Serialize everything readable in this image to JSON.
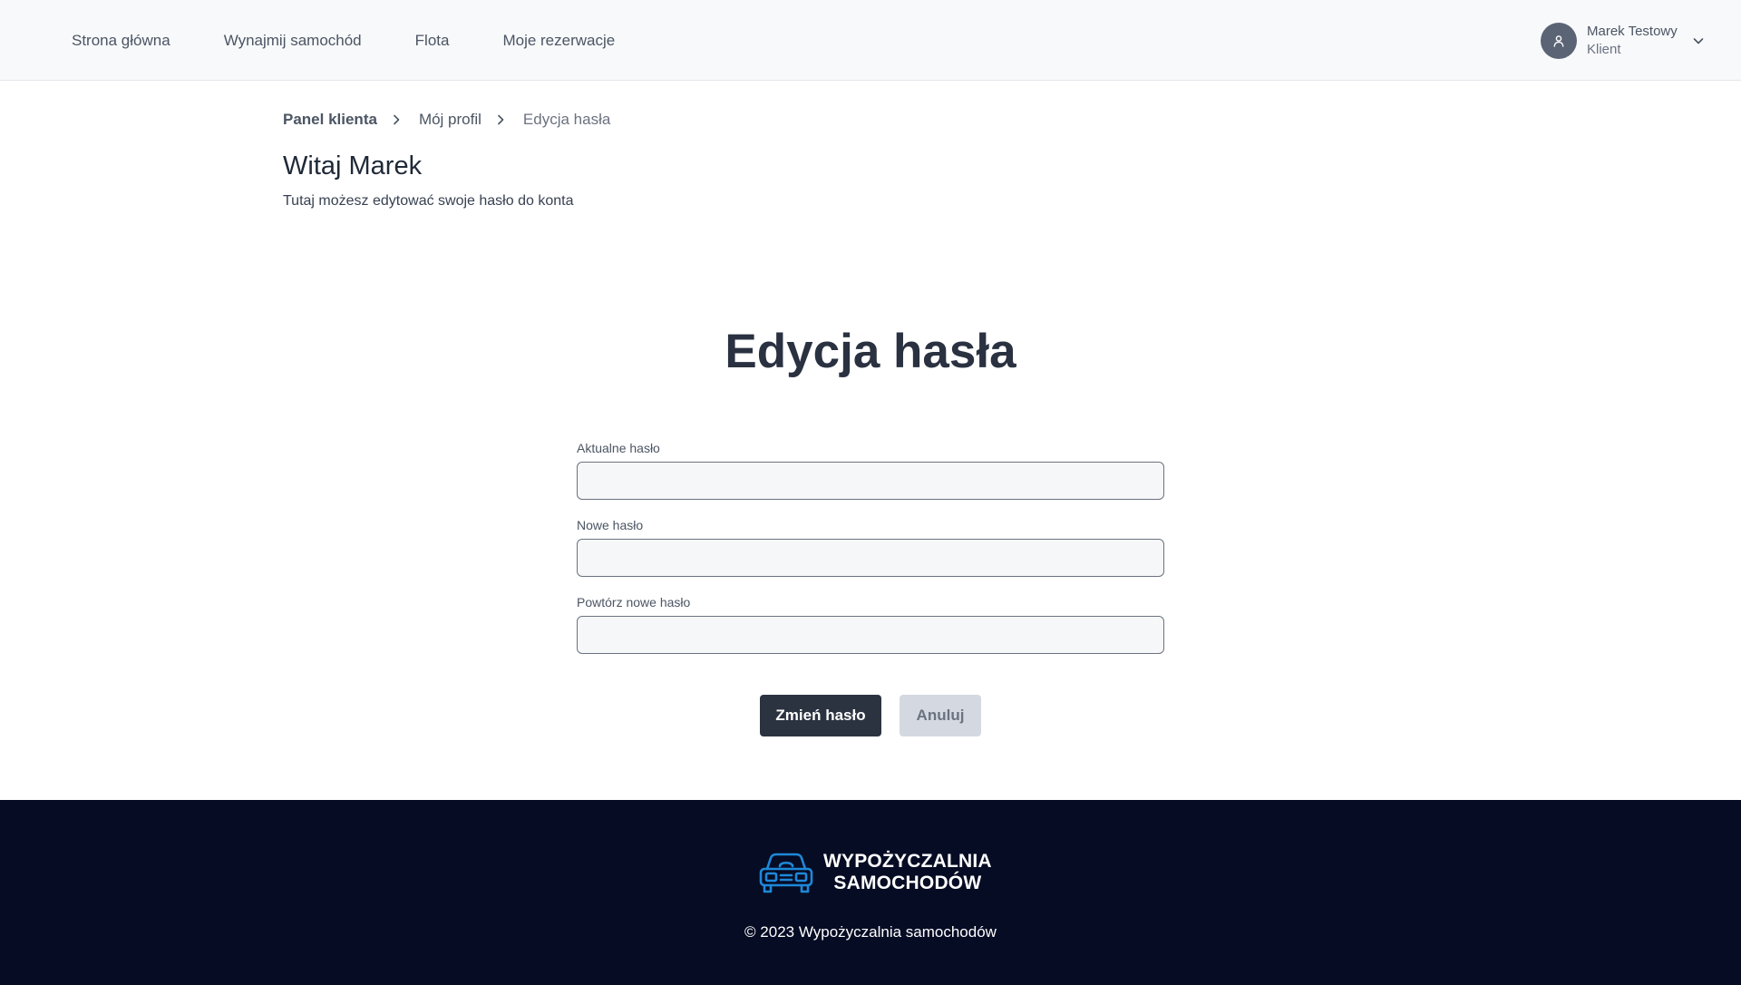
{
  "nav": {
    "links": [
      "Strona główna",
      "Wynajmij samochód",
      "Flota",
      "Moje rezerwacje"
    ]
  },
  "user": {
    "name": "Marek Testowy",
    "role": "Klient",
    "avatar_icon": "user-icon",
    "dropdown_icon": "chevron-down-icon"
  },
  "breadcrumb": {
    "items": [
      "Panel klienta",
      "Mój profil"
    ],
    "current": "Edycja hasła"
  },
  "header": {
    "greeting": "Witaj Marek",
    "subtitle": "Tutaj możesz edytować swoje hasło do konta"
  },
  "form": {
    "title": "Edycja hasła",
    "fields": [
      {
        "label": "Aktualne hasło",
        "value": ""
      },
      {
        "label": "Nowe hasło",
        "value": ""
      },
      {
        "label": "Powtórz nowe hasło",
        "value": ""
      }
    ],
    "submit_label": "Zmień hasło",
    "cancel_label": "Anuluj"
  },
  "footer": {
    "brand_line1": "WYPOŻYCZALNIA",
    "brand_line2": "SAMOCHODÓW",
    "brand_icon": "car-icon",
    "copyright": "© 2023 Wypożyczalnia samochodów"
  },
  "colors": {
    "primary": "#2c3340",
    "footer_bg": "#060c24",
    "logo_blue": "#1e88d8"
  }
}
